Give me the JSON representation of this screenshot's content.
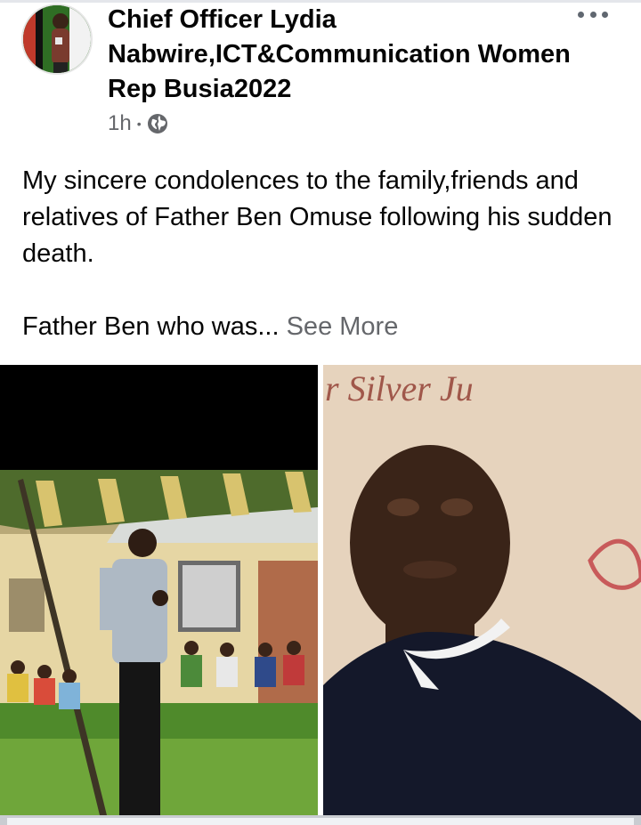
{
  "post": {
    "author": "Chief Officer Lydia Nabwire,ICT&Communication Women Rep Busia2022",
    "time": "1h",
    "separator": "•",
    "privacy_icon": "globe-icon",
    "menu_icon": "more-options-icon",
    "text_paragraph_1": "My sincere condolences to the family,friends and relatives of Father Ben Omuse following his sudden death.",
    "text_paragraph_2": "Father Ben who was...",
    "see_more_label": "See More",
    "banner_text": "r Silver Ju"
  },
  "colors": {
    "text_primary": "#050505",
    "text_secondary": "#65676b",
    "divider": "#c9ccd1"
  }
}
